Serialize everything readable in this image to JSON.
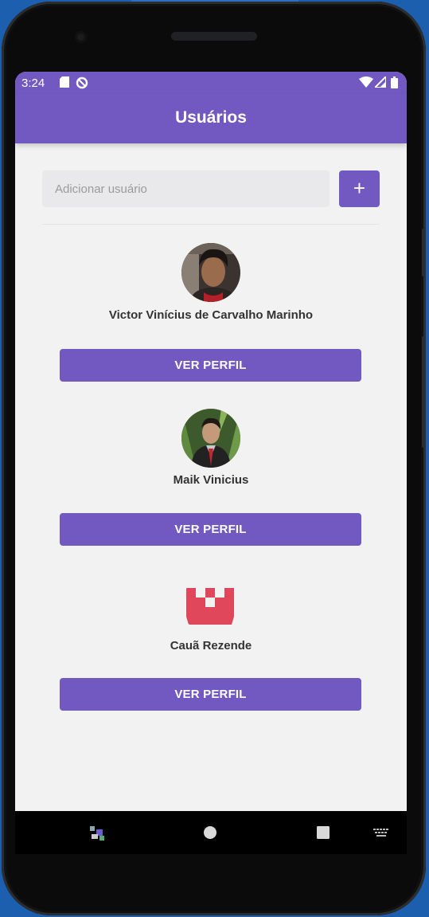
{
  "status_bar": {
    "time": "3:24",
    "icons": [
      "sd-card-icon",
      "data-saver-icon",
      "wifi-icon",
      "signal-icon",
      "battery-icon"
    ]
  },
  "app_bar": {
    "title": "Usuários"
  },
  "add_user_form": {
    "input_placeholder": "Adicionar usuário",
    "input_value": "",
    "add_button_label": "+"
  },
  "users": [
    {
      "name": "Victor Vinícius de Carvalho Marinho",
      "button_label": "VER PERFIL"
    },
    {
      "name": "Maik Vinicius",
      "button_label": "VER PERFIL"
    },
    {
      "name": "Cauã Rezende",
      "button_label": "VER PERFIL"
    }
  ],
  "navigation_bar": {
    "items": [
      "app-thumbnail-icon",
      "home-icon",
      "recents-icon",
      "keyboard-icon"
    ]
  },
  "colors": {
    "primary": "#7159c1",
    "screen_background": "#f2f2f3",
    "input_background": "#e9e9eb",
    "identicon": "#e0475a"
  }
}
